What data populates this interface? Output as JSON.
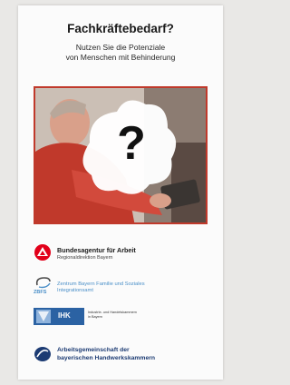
{
  "flyer": {
    "title": "Fachkräftebedarf?",
    "subtitle_line1": "Nutzen Sie die Potenziale",
    "subtitle_line2": "von Menschen mit Behinderung",
    "photo_overlay": "?"
  },
  "logos": {
    "ba": {
      "name": "Bundesagentur für Arbeit",
      "sub": "Regionaldirektion Bayern",
      "color": "#e2001a"
    },
    "zbfs": {
      "abbr": "ZBFS",
      "line1": "Zentrum Bayern Familie und Soziales",
      "line2": "Integrationsamt",
      "color": "#4a8fc8"
    },
    "ihk": {
      "label": "IHK",
      "small_line1": "Industrie- und Handelskammern",
      "small_line2": "in Bayern",
      "color": "#2b62a3"
    },
    "hwk": {
      "line1": "Arbeitsgemeinschaft der",
      "line2": "bayerischen Handwerkskammern",
      "color": "#1c3b73"
    }
  }
}
